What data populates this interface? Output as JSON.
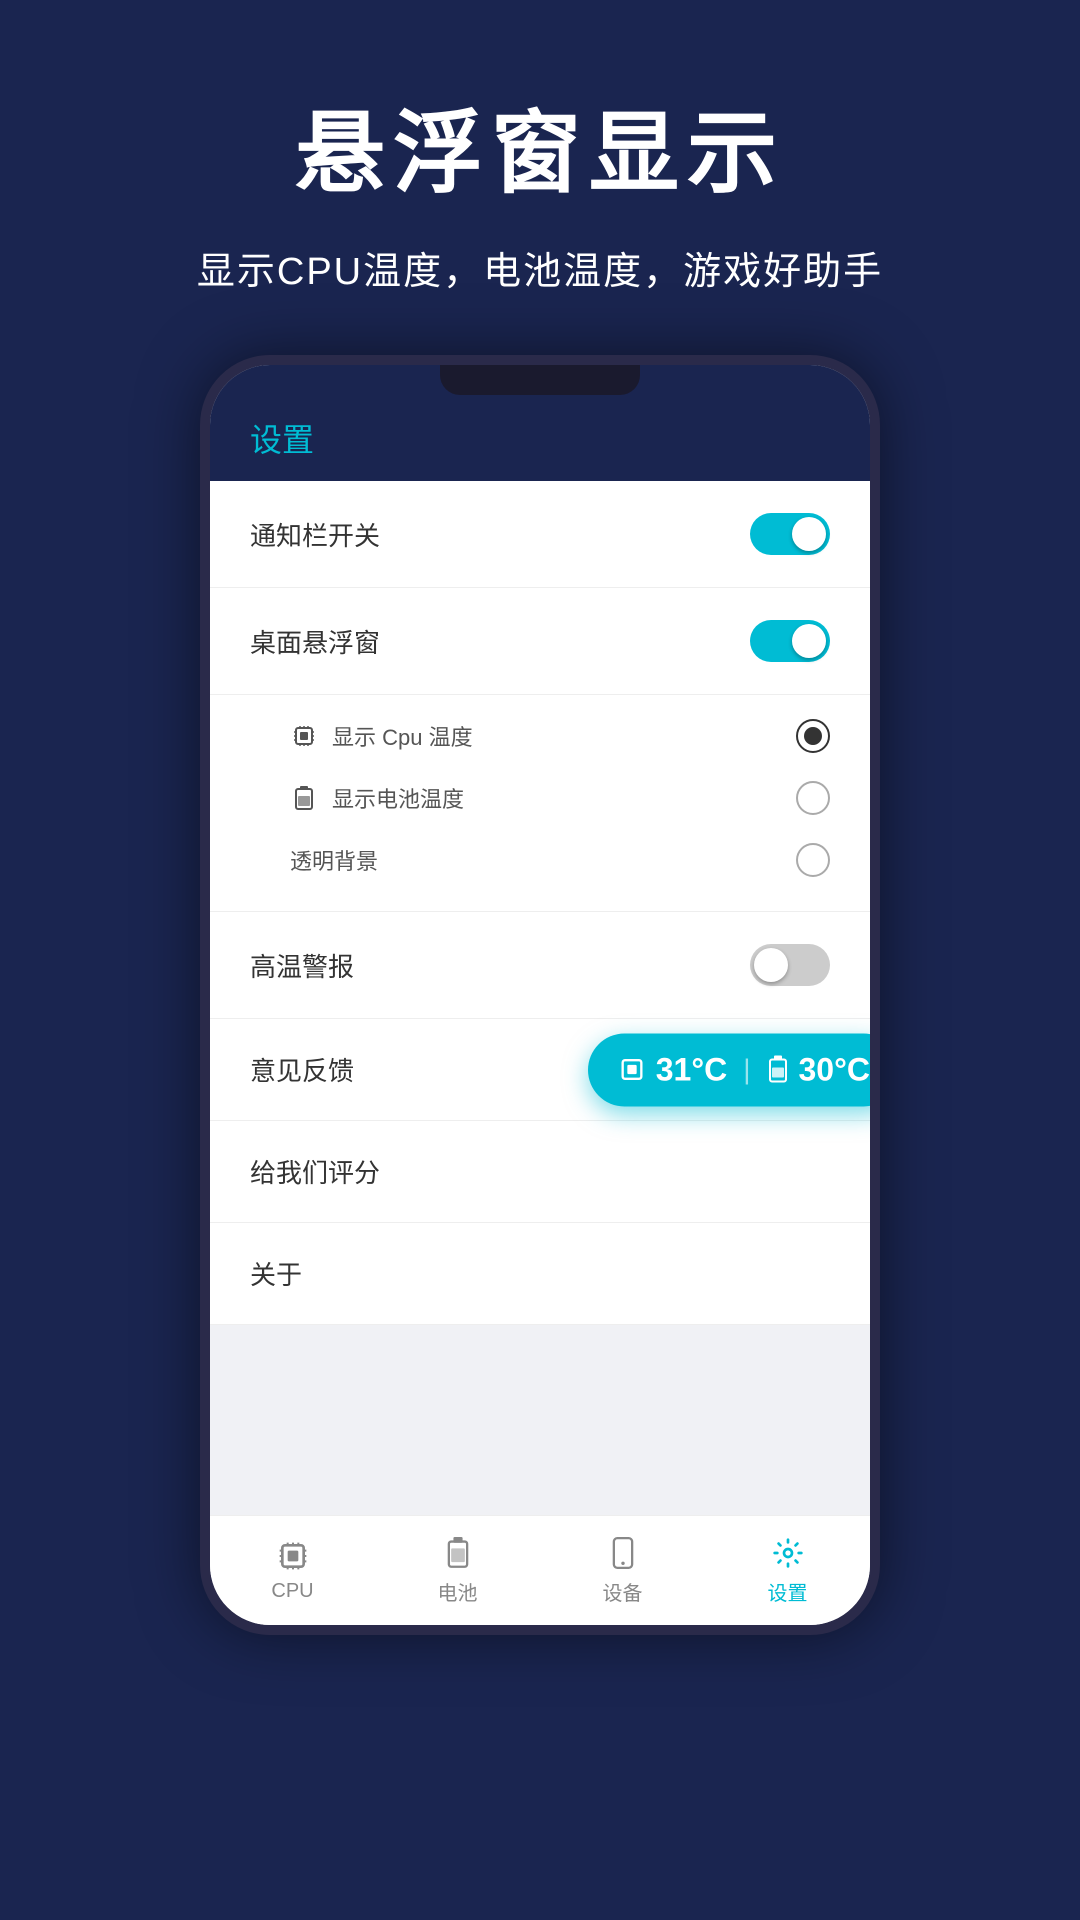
{
  "header": {
    "main_title": "悬浮窗显示",
    "subtitle": "显示CPU温度，电池温度，游戏好助手"
  },
  "settings": {
    "title": "设置",
    "items": [
      {
        "id": "notification-toggle",
        "label": "通知栏开关",
        "type": "toggle",
        "state": "on"
      },
      {
        "id": "float-window-toggle",
        "label": "桌面悬浮窗",
        "type": "toggle",
        "state": "on"
      },
      {
        "id": "float-options",
        "type": "sub-items",
        "sub": [
          {
            "id": "show-cpu-temp",
            "icon": "cpu",
            "label": "显示 Cpu 温度",
            "selected": true
          },
          {
            "id": "show-battery-temp",
            "icon": "battery",
            "label": "显示电池温度",
            "selected": false
          },
          {
            "id": "transparent-bg",
            "icon": "none",
            "label": "透明背景",
            "selected": false
          }
        ]
      },
      {
        "id": "high-temp-alert",
        "label": "高温警报",
        "type": "toggle",
        "state": "off"
      },
      {
        "id": "feedback",
        "label": "意见反馈",
        "type": "arrow"
      },
      {
        "id": "rate-us",
        "label": "给我们评分",
        "type": "arrow"
      },
      {
        "id": "about",
        "label": "关于",
        "type": "arrow"
      }
    ]
  },
  "floating_badge": {
    "cpu_temp": "31°C",
    "battery_temp": "30°C"
  },
  "bottom_nav": {
    "items": [
      {
        "id": "nav-cpu",
        "label": "CPU",
        "icon": "cpu",
        "active": false
      },
      {
        "id": "nav-battery",
        "label": "电池",
        "icon": "battery",
        "active": false
      },
      {
        "id": "nav-device",
        "label": "设备",
        "icon": "device",
        "active": false
      },
      {
        "id": "nav-settings",
        "label": "设置",
        "icon": "settings",
        "active": true
      }
    ]
  }
}
